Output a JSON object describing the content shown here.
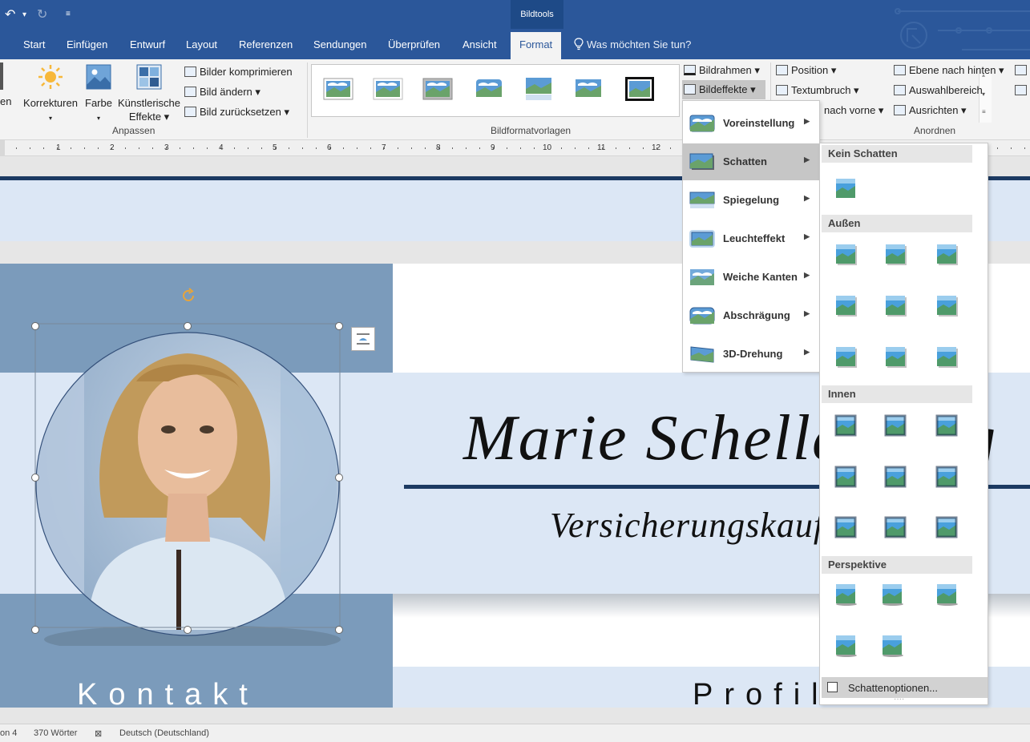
{
  "qat": {
    "undo_icon": "undo-icon",
    "redo_icon": "redo-icon",
    "customize_icon": "customize-icon"
  },
  "contextual_group": "Bildtools",
  "tabs": [
    {
      "label": "Start"
    },
    {
      "label": "Einfügen"
    },
    {
      "label": "Entwurf"
    },
    {
      "label": "Layout"
    },
    {
      "label": "Referenzen"
    },
    {
      "label": "Sendungen"
    },
    {
      "label": "Überprüfen"
    },
    {
      "label": "Ansicht"
    },
    {
      "label": "Format",
      "active": true
    }
  ],
  "tell_me": "Was möchten Sie tun?",
  "ribbon": {
    "cut_label": "en",
    "korrekturen": "Korrekturen",
    "farbe": "Farbe",
    "kuenstlerische_1": "Künstlerische",
    "kuenstlerische_2": "Effekte ▾",
    "bilder_komprimieren": "Bilder komprimieren",
    "bild_aendern": "Bild ändern ▾",
    "bild_zuruecksetzen": "Bild zurücksetzen ▾",
    "anpassen_label": "Anpassen",
    "bildformatvorlagen_label": "Bildformatvorlagen",
    "bildrahmen": "Bildrahmen ▾",
    "bildeffekte": "Bildeffekte ▾",
    "position": "Position ▾",
    "textumbruch": "Textumbruch ▾",
    "nach_vorne": "nach vorne ▾",
    "ebene_nach_hinten": "Ebene nach hinten ▾",
    "auswahlbereich": "Auswahlbereich",
    "ausrichten": "Ausrichten ▾",
    "anordnen_label": "Anordnen"
  },
  "ruler_numbers": [
    "1",
    "1",
    "2",
    "3",
    "4",
    "5",
    "6",
    "7",
    "8",
    "9",
    "10",
    "11",
    "12"
  ],
  "document": {
    "name": "Marie Schellenberg",
    "job_title": "Versicherungskauffrau",
    "kontakt": "Kontakt",
    "profil": "Profil"
  },
  "effects_menu": [
    {
      "label": "Voreinstellung",
      "icon": "preset-effect-icon"
    },
    {
      "label": "Schatten",
      "icon": "shadow-effect-icon",
      "active": true
    },
    {
      "label": "Spiegelung",
      "icon": "reflection-effect-icon"
    },
    {
      "label": "Leuchteffekt",
      "icon": "glow-effect-icon"
    },
    {
      "label": "Weiche Kanten",
      "icon": "soft-edges-effect-icon"
    },
    {
      "label": "Abschrägung",
      "icon": "bevel-effect-icon"
    },
    {
      "label": "3D-Drehung",
      "icon": "3d-rotation-effect-icon"
    }
  ],
  "shadow_panel": {
    "kein_schatten": "Kein Schatten",
    "aussen": "Außen",
    "innen": "Innen",
    "perspektive": "Perspektive",
    "options": "Schattenoptionen..."
  },
  "statusbar": {
    "page": "on 4",
    "words": "370 Wörter",
    "language": "Deutsch (Deutschland)"
  },
  "colors": {
    "title_bar": "#2b579a",
    "sidebar_blue": "#7b9bbb",
    "light_band": "#dce7f5",
    "navy_rule": "#1c3a62"
  }
}
